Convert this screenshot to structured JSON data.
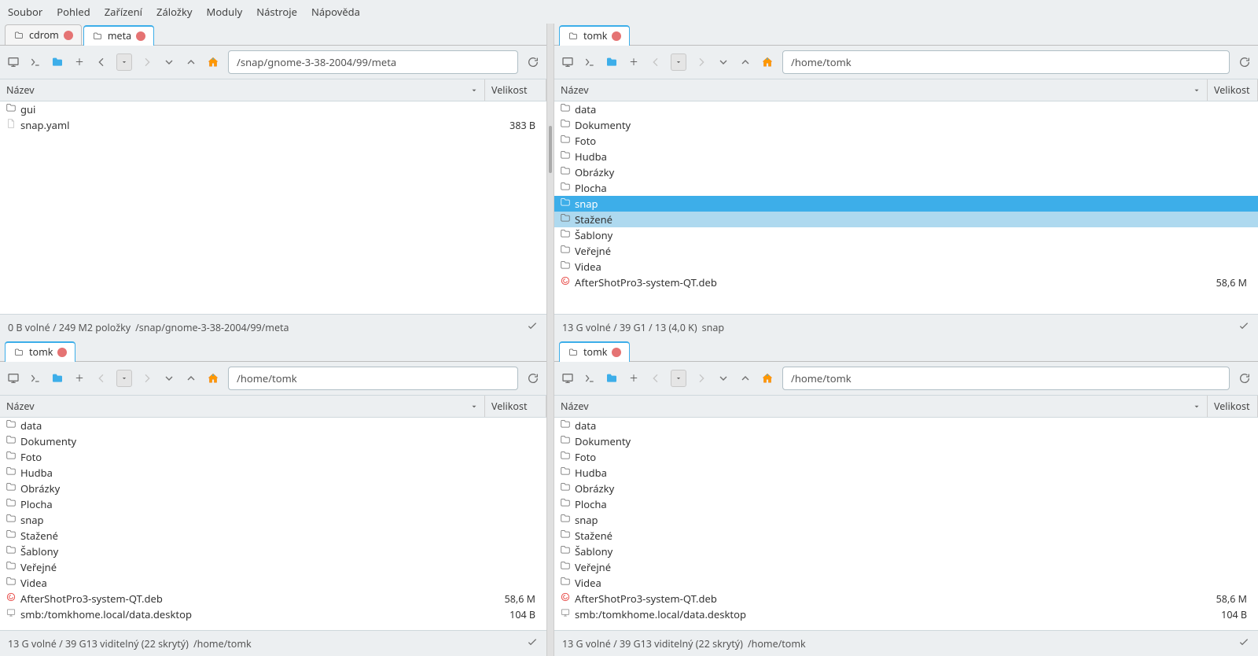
{
  "menu": [
    "Soubor",
    "Pohled",
    "Zařízení",
    "Záložky",
    "Moduly",
    "Nástroje",
    "Nápověda"
  ],
  "columns": {
    "name": "Název",
    "size": "Velikost"
  },
  "panels": {
    "tl": {
      "tabs": [
        {
          "label": "cdrom",
          "active": false
        },
        {
          "label": "meta",
          "active": true
        }
      ],
      "path": "/snap/gnome-3-38-2004/99/meta",
      "rows": [
        {
          "icon": "folder",
          "name": "gui",
          "size": ""
        },
        {
          "icon": "file",
          "name": "snap.yaml",
          "size": "383 B"
        }
      ],
      "status": "0 B volné / 249 M2 položky",
      "statusPath": "/snap/gnome-3-38-2004/99/meta"
    },
    "tr": {
      "tabs": [
        {
          "label": "tomk",
          "active": true
        }
      ],
      "path": "/home/tomk",
      "rows": [
        {
          "icon": "folder",
          "name": "data",
          "size": ""
        },
        {
          "icon": "folder",
          "name": "Dokumenty",
          "size": ""
        },
        {
          "icon": "folder",
          "name": "Foto",
          "size": ""
        },
        {
          "icon": "folder",
          "name": "Hudba",
          "size": ""
        },
        {
          "icon": "folder",
          "name": "Obrázky",
          "size": ""
        },
        {
          "icon": "folder",
          "name": "Plocha",
          "size": ""
        },
        {
          "icon": "folder",
          "name": "snap",
          "size": "",
          "selected": true
        },
        {
          "icon": "folder",
          "name": "Stažené",
          "size": "",
          "hover": true
        },
        {
          "icon": "folder",
          "name": "Šablony",
          "size": ""
        },
        {
          "icon": "folder",
          "name": "Veřejné",
          "size": ""
        },
        {
          "icon": "folder",
          "name": "Videa",
          "size": ""
        },
        {
          "icon": "deb",
          "name": "AfterShotPro3-system-QT.deb",
          "size": "58,6 M"
        }
      ],
      "status": "13 G volné / 39 G1 / 13 (4,0 K)",
      "statusPath": "snap"
    },
    "bl": {
      "tabs": [
        {
          "label": "tomk",
          "active": true
        }
      ],
      "path": "/home/tomk",
      "rows": [
        {
          "icon": "folder",
          "name": "data",
          "size": ""
        },
        {
          "icon": "folder",
          "name": "Dokumenty",
          "size": ""
        },
        {
          "icon": "folder",
          "name": "Foto",
          "size": ""
        },
        {
          "icon": "folder",
          "name": "Hudba",
          "size": ""
        },
        {
          "icon": "folder",
          "name": "Obrázky",
          "size": ""
        },
        {
          "icon": "folder",
          "name": "Plocha",
          "size": ""
        },
        {
          "icon": "folder",
          "name": "snap",
          "size": ""
        },
        {
          "icon": "folder",
          "name": "Stažené",
          "size": ""
        },
        {
          "icon": "folder",
          "name": "Šablony",
          "size": ""
        },
        {
          "icon": "folder",
          "name": "Veřejné",
          "size": ""
        },
        {
          "icon": "folder",
          "name": "Videa",
          "size": ""
        },
        {
          "icon": "deb",
          "name": "AfterShotPro3-system-QT.deb",
          "size": "58,6 M"
        },
        {
          "icon": "desktop",
          "name": "smb:/tomkhome.local/data.desktop",
          "size": "104 B"
        }
      ],
      "status": "13 G volné / 39 G13 viditelný (22 skrytý)",
      "statusPath": "/home/tomk"
    },
    "br": {
      "tabs": [
        {
          "label": "tomk",
          "active": true
        }
      ],
      "path": "/home/tomk",
      "rows": [
        {
          "icon": "folder",
          "name": "data",
          "size": ""
        },
        {
          "icon": "folder",
          "name": "Dokumenty",
          "size": ""
        },
        {
          "icon": "folder",
          "name": "Foto",
          "size": ""
        },
        {
          "icon": "folder",
          "name": "Hudba",
          "size": ""
        },
        {
          "icon": "folder",
          "name": "Obrázky",
          "size": ""
        },
        {
          "icon": "folder",
          "name": "Plocha",
          "size": ""
        },
        {
          "icon": "folder",
          "name": "snap",
          "size": ""
        },
        {
          "icon": "folder",
          "name": "Stažené",
          "size": ""
        },
        {
          "icon": "folder",
          "name": "Šablony",
          "size": ""
        },
        {
          "icon": "folder",
          "name": "Veřejné",
          "size": ""
        },
        {
          "icon": "folder",
          "name": "Videa",
          "size": ""
        },
        {
          "icon": "deb",
          "name": "AfterShotPro3-system-QT.deb",
          "size": "58,6 M"
        },
        {
          "icon": "desktop",
          "name": "smb:/tomkhome.local/data.desktop",
          "size": "104 B"
        }
      ],
      "status": "13 G volné / 39 G13 viditelný (22 skrytý)",
      "statusPath": "/home/tomk"
    }
  }
}
